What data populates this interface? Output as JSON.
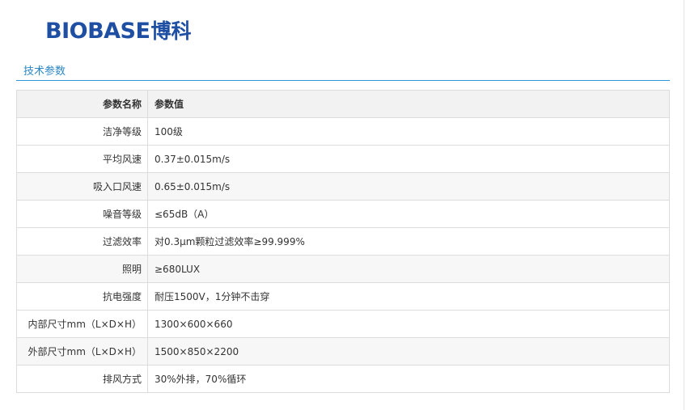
{
  "logo": {
    "latin": "BIOBASE",
    "cjk": "博科"
  },
  "section": {
    "title": "技术参数"
  },
  "table": {
    "header": {
      "name": "参数名称",
      "value": "参数值"
    },
    "rows": [
      {
        "name": "洁净等级",
        "value": "100级"
      },
      {
        "name": "平均风速",
        "value": "0.37±0.015m/s"
      },
      {
        "name": "吸入口风速",
        "value": "0.65±0.015m/s"
      },
      {
        "name": "噪音等级",
        "value": "≤65dB（A）"
      },
      {
        "name": "过滤效率",
        "value": "对0.3μm颗粒过滤效率≥99.999%"
      },
      {
        "name": "照明",
        "value": "≥680LUX"
      },
      {
        "name": "抗电强度",
        "value": "耐压1500V，1分钟不击穿"
      },
      {
        "name": "内部尺寸mm（L×D×H）",
        "value": "1300×600×660"
      },
      {
        "name": "外部尺寸mm（L×D×H）",
        "value": "1500×850×2200"
      },
      {
        "name": "排风方式",
        "value": "30%外排，70%循环"
      }
    ]
  }
}
